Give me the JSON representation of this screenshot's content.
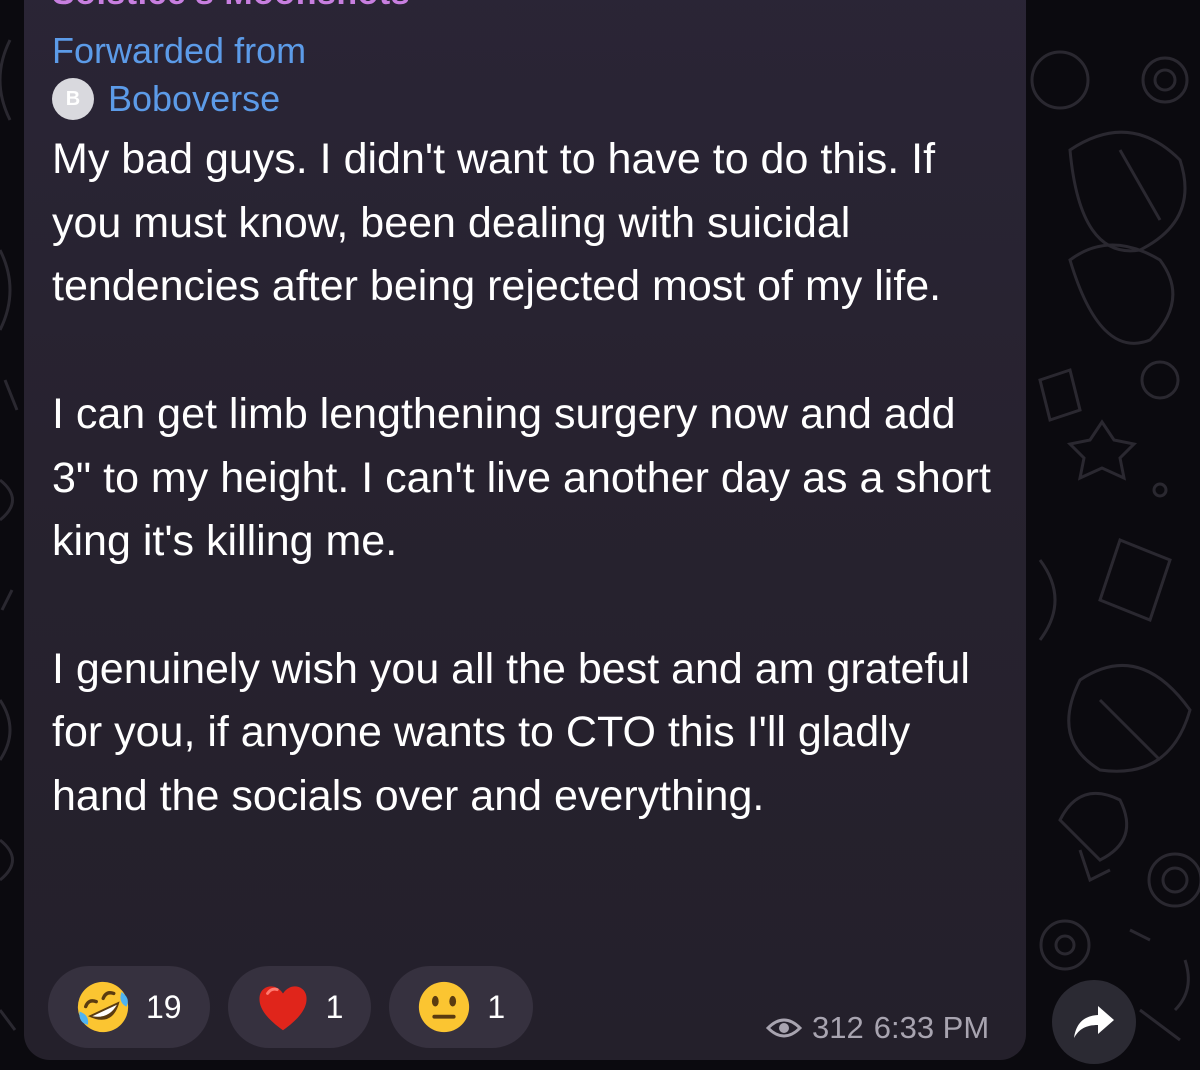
{
  "channel": {
    "name": "Solstice's Moonshots"
  },
  "forward": {
    "label": "Forwarded from",
    "source_initial": "B",
    "source_name": "Boboverse"
  },
  "message": {
    "paragraphs": [
      "My bad guys. I didn't want to have to do this. If you must know, been dealing with suicidal tendencies after being rejected most of my life.",
      "I can get limb lengthening surgery now and add 3\" to my height. I can't live another day as a short king it's killing me.",
      "I genuinely wish you all the best and am grateful for you, if anyone wants to CTO this I'll gladly hand the socials over and everything."
    ]
  },
  "reactions": [
    {
      "icon": "rolling-laughing-emoji-icon",
      "count": "19"
    },
    {
      "icon": "red-heart-emoji-icon",
      "count": "1"
    },
    {
      "icon": "neutral-face-emoji-icon",
      "count": "1"
    }
  ],
  "meta": {
    "views": "312",
    "time": "6:33 PM",
    "icon": "eye-icon"
  },
  "share": {
    "icon": "share-arrow-icon"
  },
  "colors": {
    "bubble": "#27222f",
    "channel_name": "#c87fe0",
    "link_blue": "#5c9be8",
    "message_text": "#ffffff",
    "meta_text": "#a8a4b0",
    "reaction_bg": "#36313f"
  }
}
